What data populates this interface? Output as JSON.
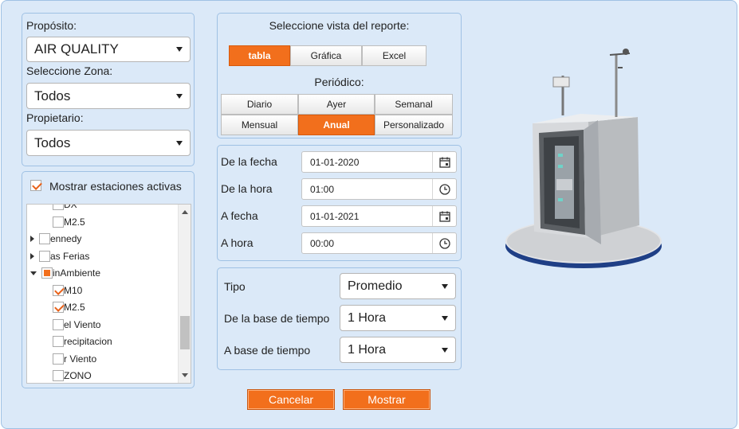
{
  "filters": {
    "purpose_label": "Propósito:",
    "purpose_value": "AIR QUALITY",
    "zone_label": "Seleccione Zona:",
    "zone_value": "Todos",
    "owner_label": "Propietario:",
    "owner_value": "Todos"
  },
  "stations": {
    "show_active_label": "Mostrar estaciones activas",
    "show_active_checked": true,
    "tree": [
      {
        "label": "DX",
        "level": 2,
        "checked": false
      },
      {
        "label": "M2.5",
        "level": 2,
        "checked": false
      },
      {
        "label": "ennedy",
        "level": 1,
        "expander": "closed",
        "checked": false
      },
      {
        "label": "as Ferias",
        "level": 1,
        "expander": "closed",
        "checked": false
      },
      {
        "label": "inAmbiente",
        "level": 1,
        "expander": "open",
        "checked": "partial"
      },
      {
        "label": "M10",
        "level": 2,
        "checked": true
      },
      {
        "label": "M2.5",
        "level": 2,
        "checked": true
      },
      {
        "label": "el Viento",
        "level": 2,
        "checked": false
      },
      {
        "label": "recipitacion",
        "level": 2,
        "checked": false
      },
      {
        "label": "r Viento",
        "level": 2,
        "checked": false
      },
      {
        "label": "ZONO",
        "level": 2,
        "checked": false
      }
    ]
  },
  "report": {
    "view_title": "Seleccione vista del reporte:",
    "views": [
      {
        "label": "tabla",
        "active": true
      },
      {
        "label": "Gráfica",
        "active": false
      },
      {
        "label": "Excel",
        "active": false
      }
    ],
    "period_title": "Periódico:",
    "periods_row1": [
      {
        "label": "Diario",
        "active": false
      },
      {
        "label": "Ayer",
        "active": false
      },
      {
        "label": "Semanal",
        "active": false
      }
    ],
    "periods_row2": [
      {
        "label": "Mensual",
        "active": false
      },
      {
        "label": "Anual",
        "active": true
      },
      {
        "label": "Personalizado",
        "active": false
      }
    ]
  },
  "dates": {
    "from_date_label": "De la fecha",
    "from_date_value": "01-01-2020",
    "from_time_label": "De la hora",
    "from_time_value": "01:00",
    "to_date_label": "A fecha",
    "to_date_value": "01-01-2021",
    "to_time_label": "A hora",
    "to_time_value": "00:00"
  },
  "options": {
    "type_label": "Tipo",
    "type_value": "Promedio",
    "from_base_label": "De la base de tiempo",
    "from_base_value": "1 Hora",
    "to_base_label": "A base de tiempo",
    "to_base_value": "1 Hora"
  },
  "actions": {
    "cancel_label": "Cancelar",
    "show_label": "Mostrar"
  },
  "colors": {
    "accent": "#f26f1c",
    "background": "#dbe9f8",
    "border": "#9fc1e4"
  },
  "illustration": {
    "icon": "air-quality-station-icon"
  }
}
